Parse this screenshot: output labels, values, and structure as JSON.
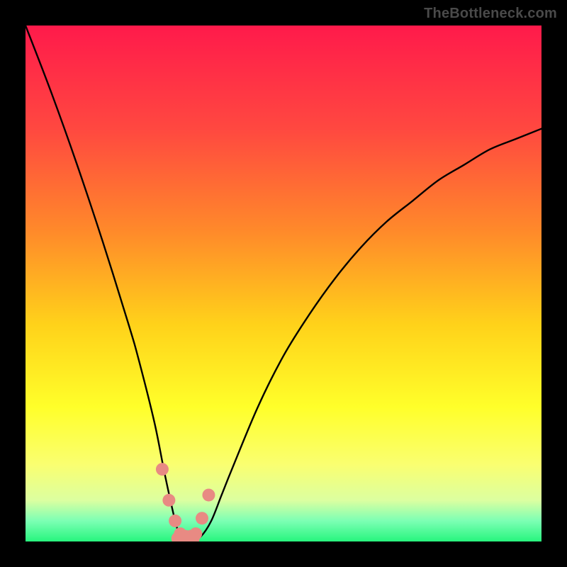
{
  "watermark": "TheBottleneck.com",
  "chart_data": {
    "type": "line",
    "title": "",
    "xlabel": "",
    "ylabel": "",
    "xlim": [
      0,
      100
    ],
    "ylim": [
      0,
      100
    ],
    "background_gradient_stops": [
      {
        "offset": 0.0,
        "color": "#ff1a4b"
      },
      {
        "offset": 0.2,
        "color": "#ff4840"
      },
      {
        "offset": 0.4,
        "color": "#ff8a2a"
      },
      {
        "offset": 0.58,
        "color": "#ffd21a"
      },
      {
        "offset": 0.74,
        "color": "#ffff2a"
      },
      {
        "offset": 0.85,
        "color": "#faff70"
      },
      {
        "offset": 0.92,
        "color": "#dcffa0"
      },
      {
        "offset": 0.96,
        "color": "#7cffb4"
      },
      {
        "offset": 1.0,
        "color": "#27f57e"
      }
    ],
    "series": [
      {
        "name": "bottleneck-curve",
        "color": "#000000",
        "x": [
          0,
          5,
          10,
          15,
          20,
          22,
          25,
          27,
          29,
          30,
          31,
          32,
          34,
          36,
          38,
          40,
          45,
          50,
          55,
          60,
          65,
          70,
          75,
          80,
          85,
          90,
          95,
          100
        ],
        "y": [
          100,
          87,
          73,
          58,
          42,
          35,
          23,
          13,
          4,
          1,
          0,
          0,
          1,
          4,
          9,
          14,
          26,
          36,
          44,
          51,
          57,
          62,
          66,
          70,
          73,
          76,
          78,
          80
        ]
      }
    ],
    "optimal_marker": {
      "color": "#e88a83",
      "x": [
        26.5,
        27.8,
        29.0,
        30.0,
        31.0,
        32.0,
        33.0,
        34.2,
        35.5
      ],
      "y": [
        14.0,
        8.0,
        4.0,
        1.5,
        1.0,
        1.0,
        1.5,
        4.5,
        9.0
      ]
    }
  }
}
